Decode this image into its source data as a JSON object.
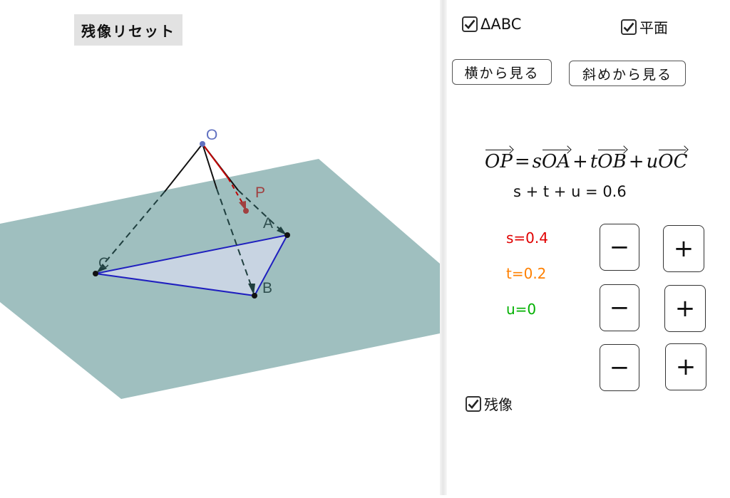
{
  "reset_button": {
    "label": "残像リセット"
  },
  "checkboxes": {
    "triangle": {
      "label": "ΔABC",
      "checked": true
    },
    "plane": {
      "label": "平面",
      "checked": true
    },
    "afterimage": {
      "label": "残像",
      "checked": true
    }
  },
  "view_buttons": {
    "side": {
      "label": "横から見る"
    },
    "oblique": {
      "label": "斜めから見る"
    }
  },
  "formula": {
    "lhs": "OP",
    "equals": "=",
    "s": "s",
    "oa": "OA",
    "plus": "+",
    "t": "t",
    "ob": "OB",
    "u": "u",
    "oc": "OC"
  },
  "condition": "s + t + u = 0.6",
  "params": {
    "s": {
      "text": "s=0.4",
      "color": "#e00000"
    },
    "t": {
      "text": "t=0.2",
      "color": "#ff8000"
    },
    "u": {
      "text": "u=0",
      "color": "#00b000"
    }
  },
  "steppers": {
    "minus_label": "−",
    "plus_label": "+"
  },
  "scene": {
    "point_labels": {
      "O": "O",
      "P": "P",
      "A": "A",
      "B": "B",
      "C": "C"
    },
    "colors": {
      "plane": "#9fbfbf",
      "triangle_fill": "#c8d4e2",
      "triangle_edge": "#1f1fbf",
      "point_O": "#6070c0",
      "vector_OP": "#c00000",
      "point_P": "#a04040"
    }
  }
}
